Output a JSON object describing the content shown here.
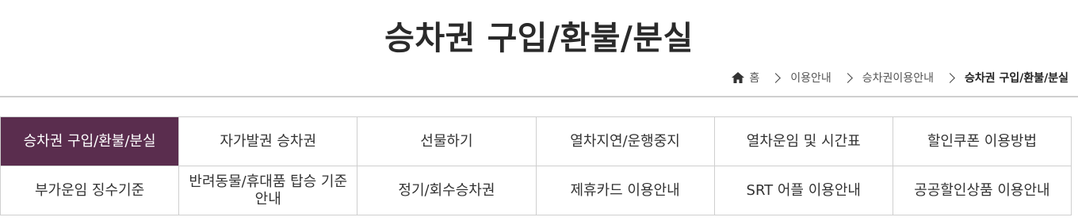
{
  "page": {
    "title": "승차권 구입/환불/분실"
  },
  "breadcrumb": {
    "home": "홈",
    "level1": "이용안내",
    "level2": "승차권이용안내",
    "current": "승차권 구입/환불/분실"
  },
  "menu": {
    "active_color": "#5a2d4e",
    "items": [
      {
        "label": "승차권 구입/환불/분실",
        "active": true
      },
      {
        "label": "자가발권 승차권"
      },
      {
        "label": "선물하기"
      },
      {
        "label": "열차지연/운행중지"
      },
      {
        "label": "열차운임 및 시간표"
      },
      {
        "label": "할인쿠폰 이용방법"
      },
      {
        "label": "부가운임 징수기준"
      },
      {
        "label": "반려동물/휴대품 탑승 기준 안내"
      },
      {
        "label": "정기/회수승차권"
      },
      {
        "label": "제휴카드 이용안내"
      },
      {
        "label": "SRT 어플 이용안내"
      },
      {
        "label": "공공할인상품 이용안내"
      }
    ]
  }
}
